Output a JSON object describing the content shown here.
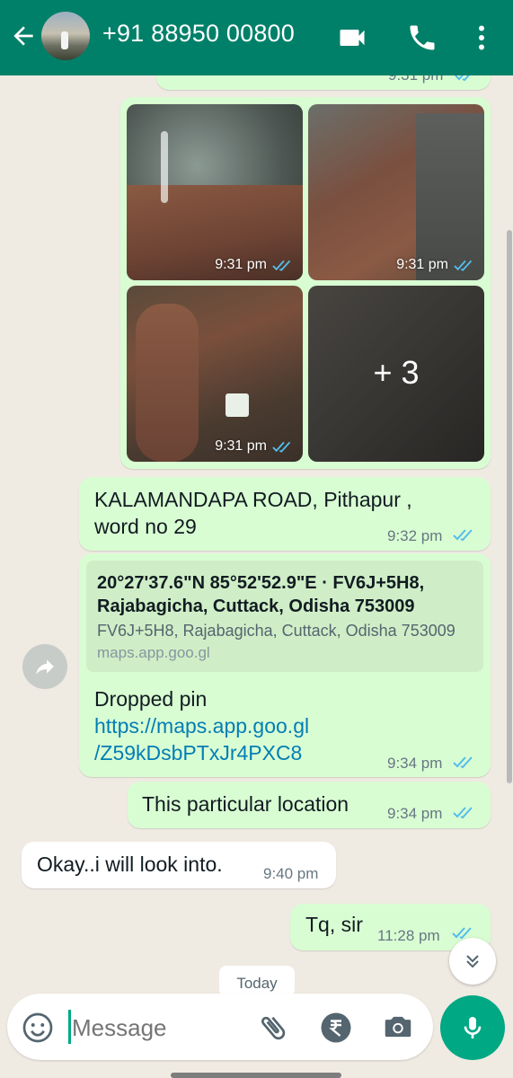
{
  "header": {
    "contact_name": "+91 88950 00800",
    "back_icon": "arrow-left-icon",
    "video_icon": "video-call-icon",
    "call_icon": "phone-icon",
    "menu_icon": "more-vertical-icon",
    "bg_color": "#008069"
  },
  "messages": {
    "prev_time": "9:31 pm",
    "photos": {
      "times": [
        "9:31 pm",
        "9:31 pm",
        "9:31 pm"
      ],
      "more_count": "+ 3"
    },
    "address": {
      "line1": "KALAMANDAPA ROAD, Pithapur ,",
      "line2": "word no 29",
      "time": "9:32 pm"
    },
    "location": {
      "card_title_line1": "20°27'37.6\"N 85°52'52.9\"E · FV6J+5H8,",
      "card_title_line2": "Rajabagicha, Cuttack, Odisha 753009",
      "card_desc": "FV6J+5H8, Rajabagicha, Cuttack, Odisha 753009",
      "card_domain": "maps.app.goo.gl",
      "text": "Dropped pin",
      "link_line1": "https://maps.app.goo.gl",
      "link_line2": "/Z59kDsbPTxJr4PXC8",
      "time": "9:34 pm"
    },
    "particular": {
      "text": "This particular location",
      "time": "9:34 pm"
    },
    "reply": {
      "text": "Okay..i will look into.",
      "time": "9:40 pm"
    },
    "tq": {
      "text": "Tq, sir",
      "time": "11:28 pm"
    },
    "date_chip": "Today"
  },
  "composer": {
    "placeholder": "Message",
    "emoji_icon": "emoji-icon",
    "attach_icon": "paperclip-icon",
    "payment_icon": "rupee-icon",
    "camera_icon": "camera-icon",
    "mic_icon": "microphone-icon",
    "accent": "#00a884"
  },
  "colors": {
    "outgoing_bubble": "#d9fdd3",
    "read_ticks": "#53bdeb",
    "link": "#027eb5"
  }
}
